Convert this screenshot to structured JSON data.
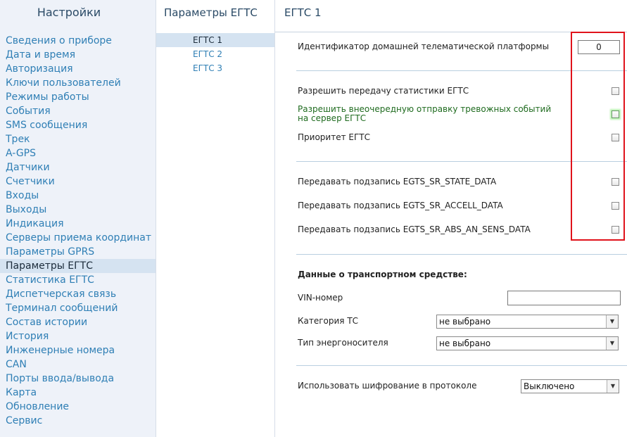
{
  "sidebar": {
    "title": "Настройки",
    "items": [
      "Сведения о приборе",
      "Дата и время",
      "Авторизация",
      "Ключи пользователей",
      "Режимы работы",
      "События",
      "SMS сообщения",
      "Трек",
      "A-GPS",
      "Датчики",
      "Счетчики",
      "Входы",
      "Выходы",
      "Индикация",
      "Серверы приема координат",
      "Параметры GPRS",
      "Параметры ЕГТС",
      "Статистика ЕГТС",
      "Диспетчерская связь",
      "Терминал сообщений",
      "Состав истории",
      "История",
      "Инженерные номера",
      "CAN",
      "Порты ввода/вывода",
      "Карта",
      "Обновление",
      "Сервис"
    ],
    "active_item": "Параметры ЕГТС"
  },
  "midcol": {
    "title": "Параметры ЕГТС",
    "items": [
      "ЕГТС 1",
      "ЕГТС 2",
      "ЕГТС 3"
    ],
    "active_item": "ЕГТС 1"
  },
  "main": {
    "title": "ЕГТС 1",
    "platform_id": {
      "label": "Идентификатор домашней телематической платформы",
      "value": "0"
    },
    "allow_stats": "Разрешить передачу статистики ЕГТС",
    "alarm_line1": "Разрешить внеочередную отправку тревожных событий",
    "alarm_line2": "на сервер ЕГТС",
    "priority": "Приоритет ЕГТС",
    "sr_state": "Передавать подзапись EGTS_SR_STATE_DATA",
    "sr_accell": "Передавать подзапись EGTS_SR_ACCELL_DATA",
    "sr_abs": "Передавать подзапись EGTS_SR_ABS_AN_SENS_DATA",
    "vehicle_header": "Данные о транспортном средстве:",
    "vin": {
      "label": "VIN-номер",
      "value": ""
    },
    "category": {
      "label": "Категория ТС",
      "value": "не выбрано"
    },
    "fuel": {
      "label": "Тип энергоносителя",
      "value": "не выбрано"
    },
    "encryption": {
      "label": "Использовать шифрование в протоколе",
      "value": "Выключено"
    }
  },
  "colors": {
    "link": "#2f7fb5",
    "active_bg": "#d5e3f1",
    "highlight": "#e0121b"
  },
  "icons": {
    "dropdown": "chevron-down-icon"
  }
}
